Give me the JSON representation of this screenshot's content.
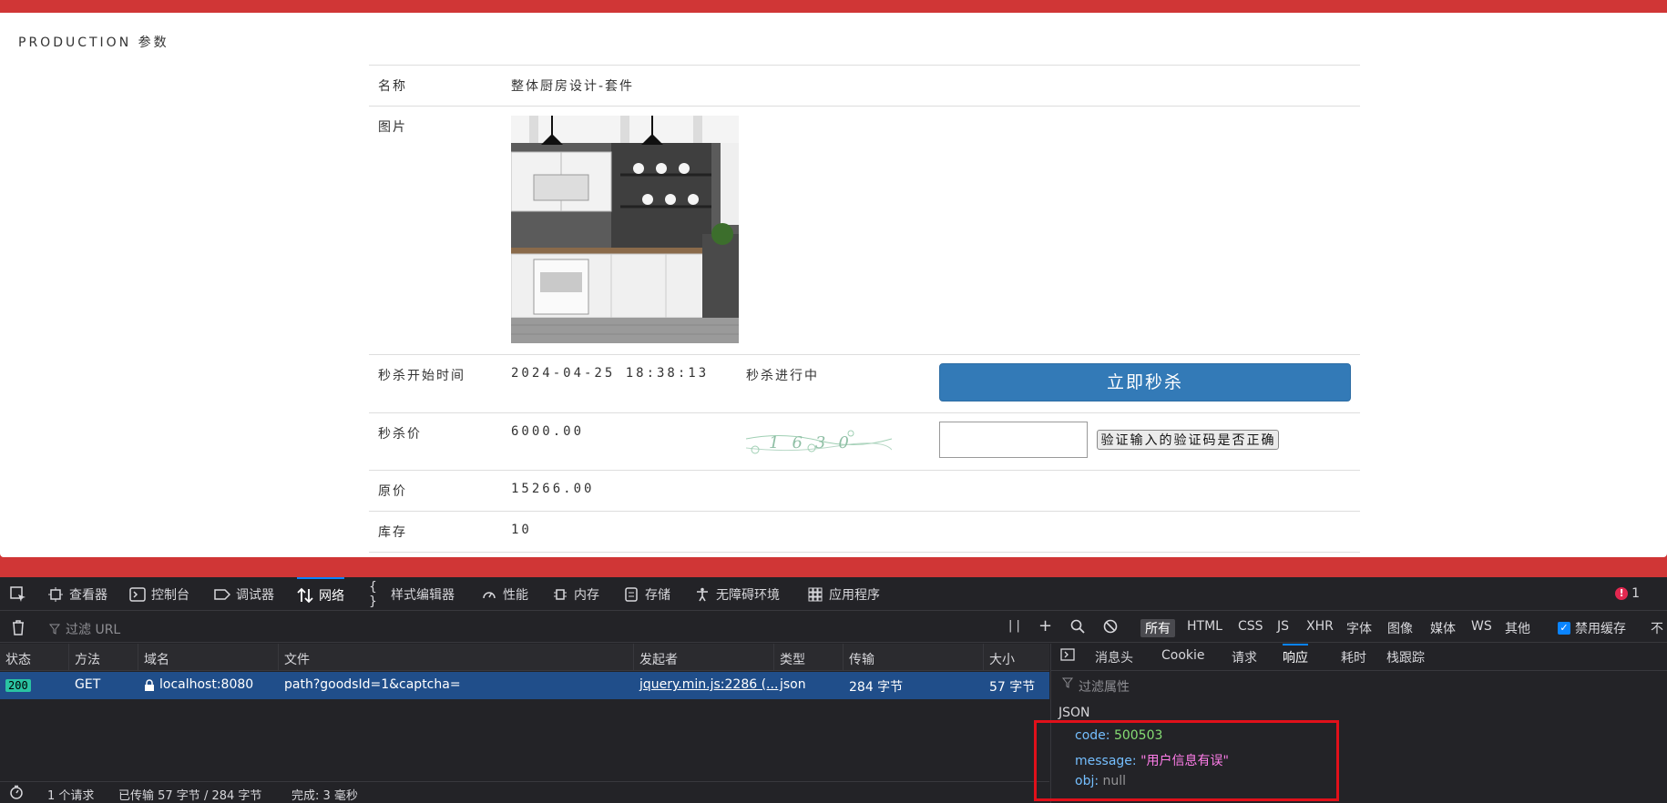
{
  "page": {
    "panel_title": "PRODUCTION 参数",
    "rows": {
      "name_label": "名称",
      "name_value": "整体厨房设计-套件",
      "image_label": "图片",
      "start_label": "秒杀开始时间",
      "start_value": "2024-04-25 18:38:13",
      "status_text": "秒杀进行中",
      "seckill_button": "立即秒杀",
      "price_label": "秒杀价",
      "price_value": "6000.00",
      "captcha_text": "1630",
      "verify_button": "验证输入的验证码是否正确",
      "orig_label": "原价",
      "orig_value": "15266.00",
      "stock_label": "库存",
      "stock_value": "10"
    }
  },
  "devtools": {
    "tabs": [
      {
        "label": "查看器",
        "icon": "inspector-icon"
      },
      {
        "label": "控制台",
        "icon": "console-icon"
      },
      {
        "label": "调试器",
        "icon": "debugger-icon"
      },
      {
        "label": "网络",
        "icon": "network-icon"
      },
      {
        "label": "样式编辑器",
        "icon": "style-editor-icon"
      },
      {
        "label": "性能",
        "icon": "performance-icon"
      },
      {
        "label": "内存",
        "icon": "memory-icon"
      },
      {
        "label": "存储",
        "icon": "storage-icon"
      },
      {
        "label": "无障碍环境",
        "icon": "accessibility-icon"
      },
      {
        "label": "应用程序",
        "icon": "application-icon"
      }
    ],
    "error_count": "1",
    "toolbar": {
      "filter_url": "过滤 URL",
      "type_filters": [
        "所有",
        "HTML",
        "CSS",
        "JS",
        "XHR",
        "字体",
        "图像",
        "媒体",
        "WS",
        "其他"
      ],
      "disable_cache": "禁用缓存",
      "more": "不"
    },
    "columns": [
      "状态",
      "方法",
      "域名",
      "文件",
      "发起者",
      "类型",
      "传输",
      "大小"
    ],
    "request": {
      "status": "200",
      "method": "GET",
      "domain": "localhost:8080",
      "file": "path?goodsId=1&captcha=",
      "initiator": "jquery.min.js:2286 (...",
      "type": "json",
      "transferred": "284 字节",
      "size": "57 字节"
    },
    "statusbar": {
      "requests": "1 个请求",
      "transferred": "已传输 57 字节 / 284 字节",
      "finish": "完成: 3 毫秒"
    },
    "side_tabs": [
      "消息头",
      "Cookie",
      "请求",
      "响应",
      "耗时",
      "栈跟踪"
    ],
    "active_side_tab": "响应",
    "prop_filter": "过滤属性",
    "json_label": "JSON",
    "json": {
      "code_key": "code:",
      "code_val": "500503",
      "message_key": "message:",
      "message_val": "\"用户信息有误\"",
      "obj_key": "obj:",
      "obj_val": "null"
    }
  }
}
